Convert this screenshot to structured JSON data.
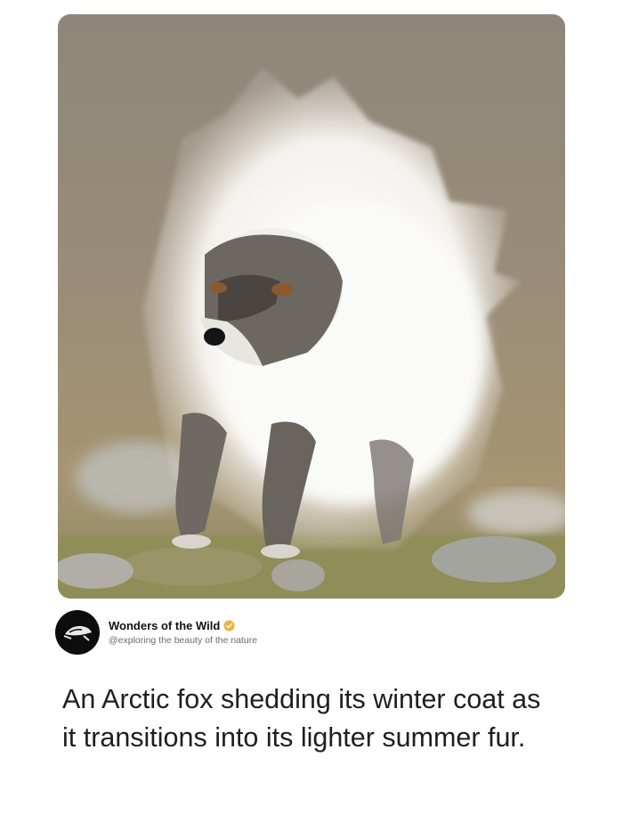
{
  "photo": {
    "alt_icon": "arctic-fox-photo"
  },
  "author": {
    "name": "Wonders of the Wild",
    "handle": "@exploring the beauty of the nature",
    "verified": true,
    "avatar_icon": "sea-turtle-icon"
  },
  "post": {
    "text": "An Arctic fox shedding its winter coat as it transitions into its lighter summer fur."
  },
  "colors": {
    "badge": "#e8b53a",
    "avatar_bg": "#0d0d0d",
    "text": "#1f1f1f",
    "handle": "#6b6b6b"
  }
}
